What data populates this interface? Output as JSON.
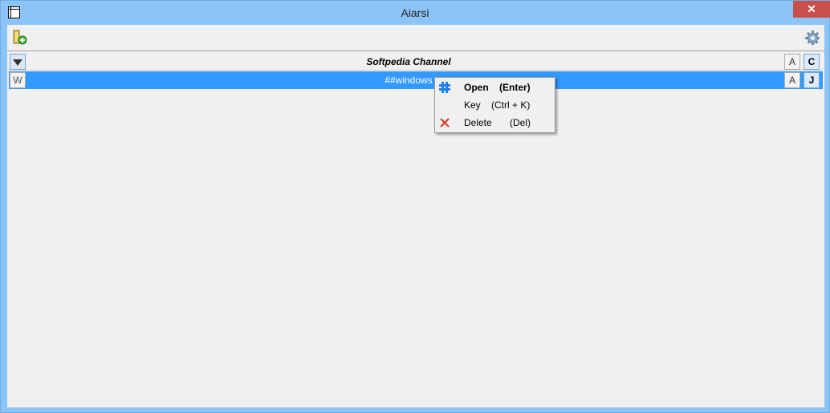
{
  "window": {
    "title": "Aiarsi",
    "close_label": "✕"
  },
  "toolbar": {
    "add_icon": "add-channel-icon",
    "settings_icon": "gear-icon"
  },
  "channels": {
    "header_row": {
      "expand_icon": "triangle-down-icon",
      "name": "Softpedia Channel",
      "btn_a": "A",
      "btn_c": "C"
    },
    "selected_row": {
      "left_btn": "W",
      "name": "##windows",
      "btn_a": "A",
      "btn_j": "J"
    }
  },
  "context_menu": {
    "items": [
      {
        "label": "Open",
        "shortcut": "(Enter)",
        "icon": "hash-icon"
      },
      {
        "label": "Key",
        "shortcut": "(Ctrl + K)",
        "icon": ""
      },
      {
        "label": "Delete",
        "shortcut": "(Del)",
        "icon": "x-icon"
      }
    ]
  },
  "colors": {
    "selection": "#3399ff",
    "titlebar": "#8cc4f7",
    "close": "#c7504a",
    "delete_icon": "#d9362b",
    "hash_icon": "#1c84e8"
  }
}
